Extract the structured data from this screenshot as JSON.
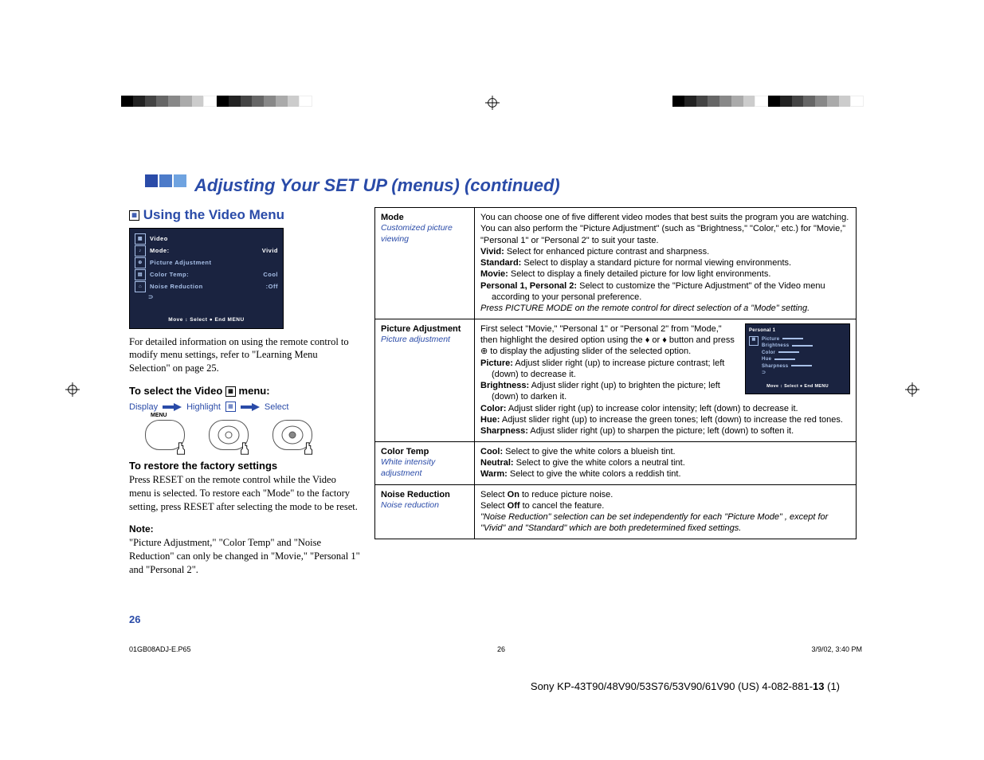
{
  "title": "Adjusting Your SET UP (menus) (continued)",
  "left": {
    "heading": "Using the Video Menu",
    "osd": {
      "line1": "Video",
      "line2_label": "Mode:",
      "line2_val": "Vivid",
      "line3": "Picture Adjustment",
      "line4_label": "Color Temp:",
      "line4_val": "Cool",
      "line5_label": "Noise Reduction",
      "line5_val": ":Off",
      "footer": "Move ↕   Select ●   End  MENU"
    },
    "para1": "For detailed information on using the remote control to modify menu settings, refer to \"Learning Menu Selection\" on page 25.",
    "sub1": "To select the Video",
    "sub1_after": "menu:",
    "proc": {
      "display": "Display",
      "highlight": "Highlight",
      "select": "Select"
    },
    "menu_label": "MENU",
    "sub2": "To restore the factory settings",
    "para2": "Press RESET on the remote control while the Video menu is selected. To restore each \"Mode\" to the factory setting, press RESET after selecting the mode to be reset.",
    "note_heading": "Note:",
    "note_body": "\"Picture Adjustment,\" \"Color Temp\" and \"Noise Reduction\" can only be changed in \"Movie,\" \"Personal 1\" and \"Personal 2\"."
  },
  "table": {
    "rows": [
      {
        "title": "Mode",
        "subtitle": "Customized picture viewing",
        "body_intro": "You can choose one of five different video modes that best suits the program you are watching. You can also perform the \"Picture Adjustment\" (such as \"Brightness,\" \"Color,\" etc.) for \"Movie,\" \"Personal 1\" or \"Personal 2\" to suit your taste.",
        "defs": [
          {
            "term": "Vivid:",
            "text": " Select for enhanced picture contrast and sharpness."
          },
          {
            "term": "Standard:",
            "text": " Select to display a standard picture for normal viewing environments."
          },
          {
            "term": "Movie:",
            "text": " Select to display a finely detailed picture for low light environments."
          },
          {
            "term": "Personal 1, Personal 2:",
            "text": " Select to customize the \"Picture Adjustment\" of the Video menu according to your personal preference."
          }
        ],
        "body_outro_italic": "Press PICTURE MODE on the remote control for direct selection of a \"Mode\" setting."
      },
      {
        "title": "Picture Adjustment",
        "subtitle": "Picture adjustment",
        "body_intro": "First select \"Movie,\" \"Personal 1\" or \"Personal 2\" from \"Mode,\" then highlight the desired option using the ♦ or ♦ button and press  ⊕  to display the adjusting slider of the selected option.",
        "defs": [
          {
            "term": "Picture:",
            "text": " Adjust slider right (up) to increase picture contrast;  left (down) to decrease it."
          },
          {
            "term": "Brightness:",
            "text": " Adjust slider right (up) to brighten the picture;  left (down) to darken it."
          },
          {
            "term": "Color:",
            "text": " Adjust slider right (up) to increase color intensity;  left (down) to decrease it."
          },
          {
            "term": "Hue:",
            "text": " Adjust slider right (up) to increase the green tones; left (down) to increase the red tones."
          },
          {
            "term": "Sharpness:",
            "text": " Adjust slider right (up) to sharpen the picture; left (down) to soften it."
          }
        ],
        "osd_small": {
          "l1": "Personal 1",
          "items": [
            "Picture",
            "Brightness",
            "Color",
            "Hue",
            "Sharpness"
          ],
          "footer": "Move ↕   Select ●   End  MENU"
        }
      },
      {
        "title": "Color Temp",
        "subtitle": "White intensity adjustment",
        "defs": [
          {
            "term": "Cool:",
            "text": " Select to give the white colors a blueish tint."
          },
          {
            "term": "Neutral:",
            "text": " Select to give the white colors a neutral tint."
          },
          {
            "term": "Warm:",
            "text": " Select to give the white colors a reddish tint."
          }
        ]
      },
      {
        "title": "Noise Reduction",
        "subtitle": "Noise reduction",
        "body_lines": [
          "Select <b>On</b> to reduce picture noise.",
          "Select <b>Off</b> to cancel the feature."
        ],
        "body_outro_italic": "\"Noise Reduction\" selection can be set independently for each \"Picture Mode\" , except for \"Vivid\" and \"Standard\"  which are both predetermined fixed settings."
      }
    ]
  },
  "page_number": "26",
  "footer": {
    "file": "01GB08ADJ-E.P65",
    "pg": "26",
    "date": "3/9/02, 3:40 PM"
  },
  "product_line_a": "Sony KP-43T90/48V90/53S76/53V90/61V90 (US) 4-082-881-",
  "product_line_b": "13",
  "product_line_c": " (1)"
}
